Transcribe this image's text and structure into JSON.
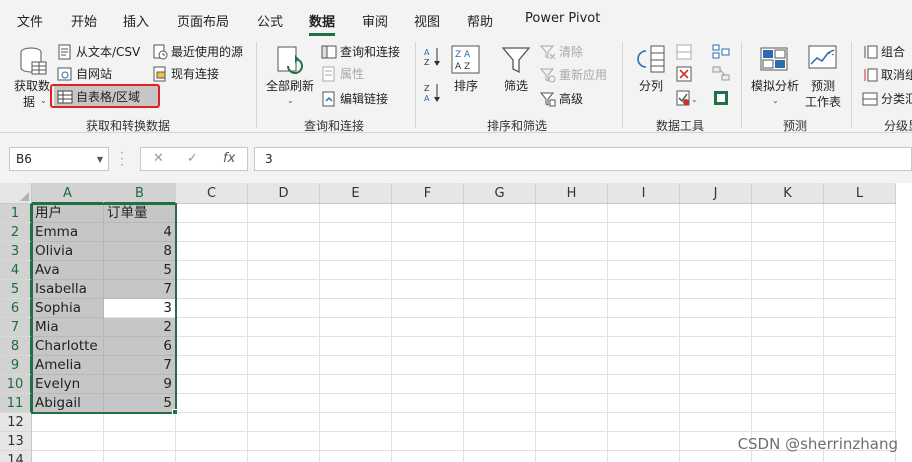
{
  "menu": {
    "tabs": [
      "文件",
      "开始",
      "插入",
      "页面布局",
      "公式",
      "数据",
      "审阅",
      "视图",
      "帮助",
      "Power Pivot"
    ],
    "active": "数据"
  },
  "ribbon": {
    "get_transform": {
      "get_data_line1": "获取数",
      "get_data_line2": "据",
      "from_text_csv": "从文本/CSV",
      "from_web": "自网站",
      "from_table_range": "自表格/区域",
      "recent_sources": "最近使用的源",
      "existing_connections": "现有连接",
      "group_label": "获取和转换数据"
    },
    "queries": {
      "refresh_all": "全部刷新",
      "queries_connections": "查询和连接",
      "properties": "属性",
      "edit_links": "编辑链接",
      "group_label": "查询和连接"
    },
    "sort_filter": {
      "sort": "排序",
      "filter": "筛选",
      "clear": "清除",
      "reapply": "重新应用",
      "advanced": "高级",
      "group_label": "排序和筛选"
    },
    "data_tools": {
      "text_to_columns": "分列",
      "group_label": "数据工具"
    },
    "forecast": {
      "what_if": "模拟分析",
      "forecast_sheet_line1": "预测",
      "forecast_sheet_line2": "工作表",
      "group_label": "预测"
    },
    "outline": {
      "group": "组合",
      "ungroup": "取消组",
      "subtotal": "分类汇",
      "group_label": "分级显"
    }
  },
  "formula_bar": {
    "name_box": "B6",
    "fx": "fx",
    "value": "3"
  },
  "sheet": {
    "columns": [
      "A",
      "B",
      "C",
      "D",
      "E",
      "F",
      "G",
      "H",
      "I",
      "J",
      "K",
      "L"
    ],
    "rows": [
      "1",
      "2",
      "3",
      "4",
      "5",
      "6",
      "7",
      "8",
      "9",
      "10",
      "11",
      "12",
      "13",
      "14"
    ],
    "header": [
      "用户",
      "订单量"
    ],
    "data": [
      [
        "Emma",
        "4"
      ],
      [
        "Olivia",
        "8"
      ],
      [
        "Ava",
        "5"
      ],
      [
        "Isabella",
        "7"
      ],
      [
        "Sophia",
        "3"
      ],
      [
        "Mia",
        "2"
      ],
      [
        "Charlotte",
        "6"
      ],
      [
        "Amelia",
        "7"
      ],
      [
        "Evelyn",
        "9"
      ],
      [
        "Abigail",
        "5"
      ]
    ]
  },
  "watermark": "CSDN @sherrinzhang",
  "colors": {
    "accent": "#1e7145",
    "highlight": "#e02020",
    "selection_fill": "#c6c6c6"
  }
}
